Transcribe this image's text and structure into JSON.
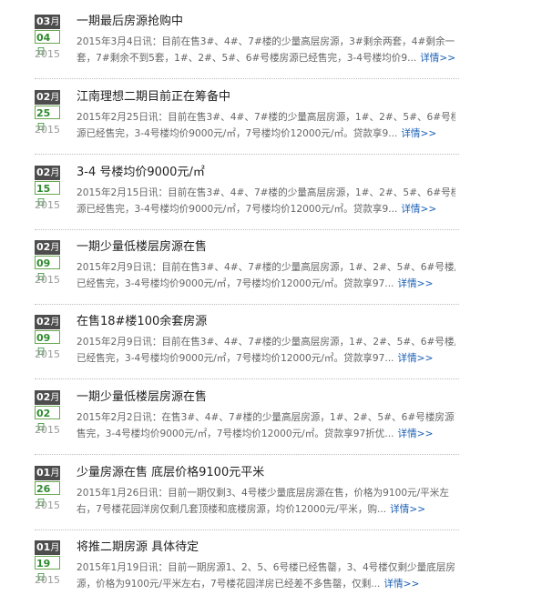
{
  "more_label": "详情>>",
  "month_unit": "月",
  "day_unit": "日",
  "items": [
    {
      "month": "03",
      "day": "04",
      "year": "2015",
      "title": "一期最后房源抢购中",
      "summary_line1": "2015年3月4日讯：目前在售3#、4#、7#楼的少量高层房源，3#剩余两套，4#剩余一",
      "summary_line2": "套，7#剩余不到5套，1#、2#、5#、6#号楼房源已经售完，3-4号楼均价9..."
    },
    {
      "month": "02",
      "day": "25",
      "year": "2015",
      "title": "江南理想二期目前正在筹备中",
      "summary_line1": "2015年2月25日讯：目前在售3#、4#、7#楼的少量高层房源，1#、2#、5#、6#号楼房",
      "summary_line2": "源已经售完，3-4号楼均价9000元/㎡，7号楼均价12000元/㎡。贷款享9..."
    },
    {
      "month": "02",
      "day": "15",
      "year": "2015",
      "title": "3-4 号楼均价9000元/㎡",
      "summary_line1": "2015年2月15日讯：目前在售3#、4#、7#楼的少量高层房源，1#、2#、5#、6#号楼房",
      "summary_line2": "源已经售完，3-4号楼均价9000元/㎡，7号楼均价12000元/㎡。贷款享9..."
    },
    {
      "month": "02",
      "day": "09",
      "year": "2015",
      "title": "一期少量低楼层房源在售",
      "summary_line1": "2015年2月9日讯：目前在售3#、4#、7#楼的少量高层房源，1#、2#、5#、6#号楼房源",
      "summary_line2": "已经售完，3-4号楼均价9000元/㎡，7号楼均价12000元/㎡。贷款享97..."
    },
    {
      "month": "02",
      "day": "09",
      "year": "2015",
      "title": "在售18#楼100余套房源",
      "summary_line1": "2015年2月9日讯：目前在售3#、4#、7#楼的少量高层房源，1#、2#、5#、6#号楼房源",
      "summary_line2": "已经售完，3-4号楼均价9000元/㎡，7号楼均价12000元/㎡。贷款享97..."
    },
    {
      "month": "02",
      "day": "02",
      "year": "2015",
      "title": "一期少量低楼层房源在售",
      "summary_line1": "2015年2月2日讯：在售3#、4#、7#楼的少量高层房源，1#、2#、5#、6#号楼房源已经",
      "summary_line2": "售完，3-4号楼均价9000元/㎡，7号楼均价12000元/㎡。贷款享97折优..."
    },
    {
      "month": "01",
      "day": "26",
      "year": "2015",
      "title": "少量房源在售 底层价格9100元平米",
      "summary_line1": "2015年1月26日讯：目前一期仅剩3、4号楼少量底层房源在售，价格为9100元/平米左",
      "summary_line2": "右，7号楼花园洋房仅剩几套顶楼和底楼房源，均价12000元/平米，购..."
    },
    {
      "month": "01",
      "day": "19",
      "year": "2015",
      "title": "将推二期房源 具体待定",
      "summary_line1": "2015年1月19日讯：目前一期房源1、2、5、6号楼已经售罄，3、4号楼仅剩少量底层房",
      "summary_line2": "源，价格为9100元/平米左右，7号楼花园洋房已经差不多售罄，仅剩..."
    }
  ]
}
